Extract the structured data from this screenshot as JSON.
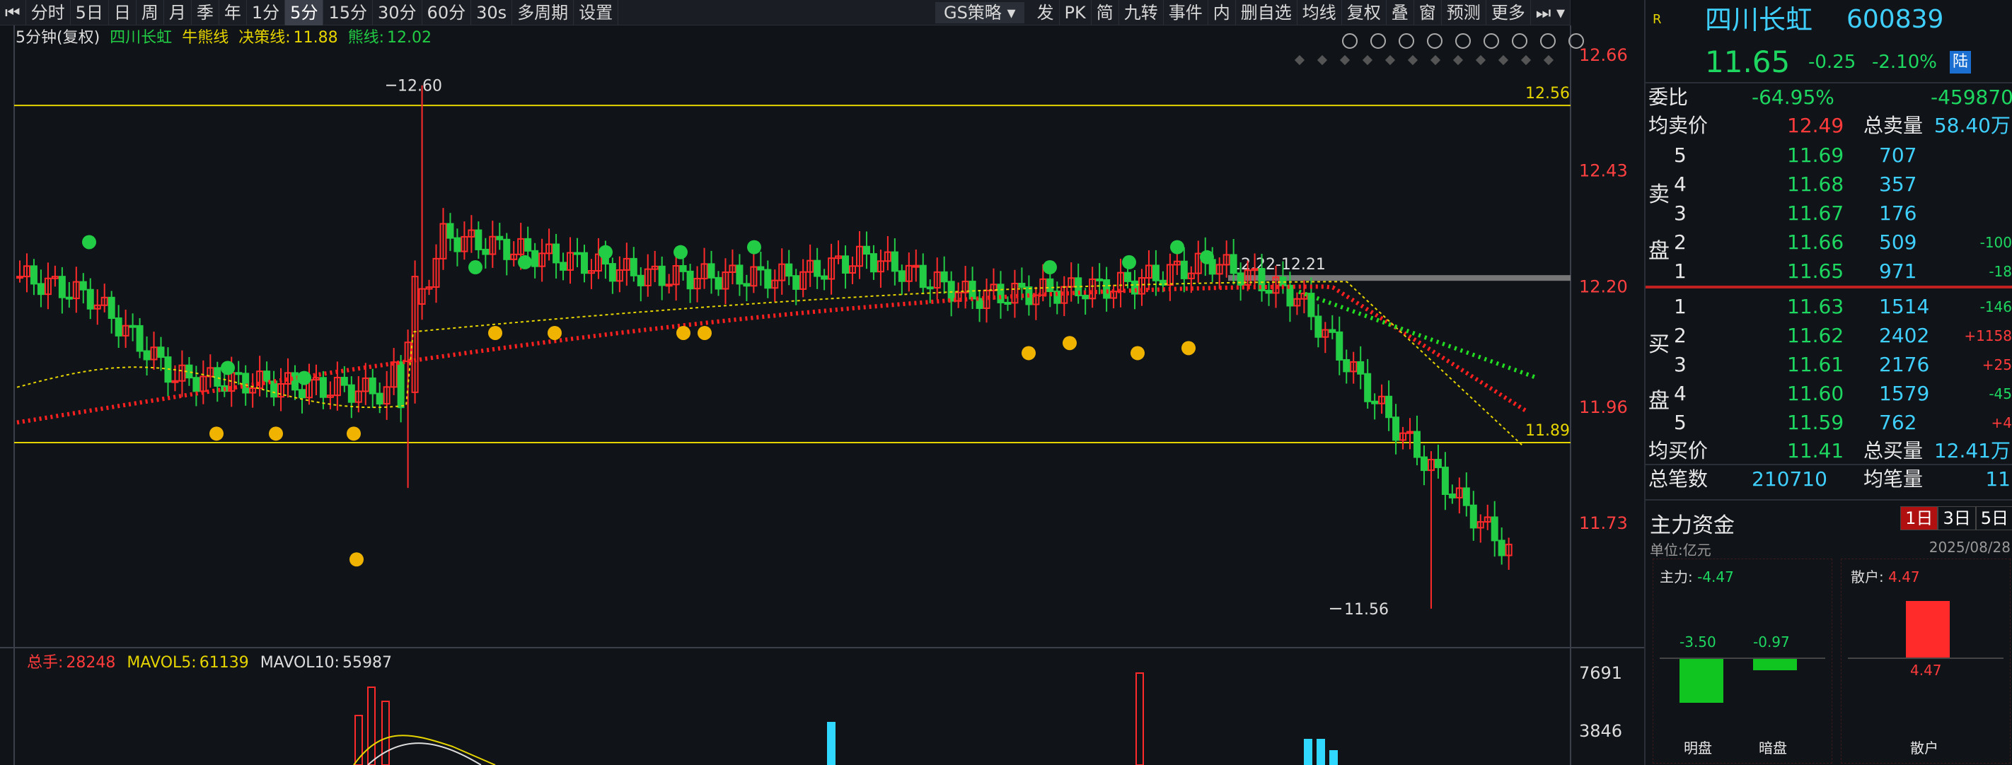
{
  "toolbar": {
    "items": [
      "分时",
      "5日",
      "日",
      "周",
      "月",
      "季",
      "年",
      "1分",
      "5分",
      "15分",
      "30分",
      "60分",
      "30s",
      "多周期",
      "设置"
    ],
    "active": "5分",
    "strategy": "GS策略",
    "right_items": [
      "发",
      "PK",
      "简",
      "九转",
      "事件",
      "内",
      "删自选",
      "均线",
      "复权",
      "叠",
      "窗",
      "预测",
      "更多"
    ]
  },
  "chart_info": {
    "period": "5分钟(复权)",
    "name": "四川长虹",
    "bull_label": "牛熊线",
    "decision_label": "决策线:",
    "decision_value": "11.88",
    "bear_label": "熊线:",
    "bear_value": "12.02"
  },
  "price_axis": [
    "12.66",
    "12.43",
    "12.20",
    "11.96",
    "11.73"
  ],
  "labels": {
    "high": "12.60",
    "low": "11.56",
    "range": "12.22-12.21",
    "line_top": "12.56",
    "line_bottom": "11.89"
  },
  "volume": {
    "total_label": "总手:",
    "total": "28248",
    "ma5_label": "MAVOL5:",
    "ma5": "61139",
    "ma10_label": "MAVOL10:",
    "ma10": "55987",
    "axis": [
      "7691",
      "3846"
    ]
  },
  "colors": {
    "up": "#ff2b2b",
    "down": "#22cc44",
    "bg": "#101318",
    "yellow": "#e6d400"
  },
  "quote": {
    "name": "四川长虹",
    "code": "600839",
    "price": "11.65",
    "change": "-0.25",
    "pct": "-2.10%",
    "market": "陆",
    "webi_label": "委比",
    "webi": "-64.95%",
    "weicha": "-459870",
    "avg_sell_label": "均卖价",
    "avg_sell": "12.49",
    "total_sell_label": "总卖量",
    "total_sell": "58.40万",
    "sell": [
      {
        "lv": "5",
        "p": "11.69",
        "v": "707",
        "d": ""
      },
      {
        "lv": "4",
        "p": "11.68",
        "v": "357",
        "d": ""
      },
      {
        "lv": "3",
        "p": "11.67",
        "v": "176",
        "d": ""
      },
      {
        "lv": "2",
        "p": "11.66",
        "v": "509",
        "d": "-100"
      },
      {
        "lv": "1",
        "p": "11.65",
        "v": "971",
        "d": "-18"
      }
    ],
    "sell_side": "卖",
    "buy_side": "买",
    "pan": "盘",
    "buy": [
      {
        "lv": "1",
        "p": "11.63",
        "v": "1514",
        "d": "-146"
      },
      {
        "lv": "2",
        "p": "11.62",
        "v": "2402",
        "d": "+1158"
      },
      {
        "lv": "3",
        "p": "11.61",
        "v": "2176",
        "d": "+25"
      },
      {
        "lv": "4",
        "p": "11.60",
        "v": "1579",
        "d": "-45"
      },
      {
        "lv": "5",
        "p": "11.59",
        "v": "762",
        "d": "+4"
      }
    ],
    "avg_buy_label": "均买价",
    "avg_buy": "11.41",
    "total_buy_label": "总买量",
    "total_buy": "12.41万",
    "total_trades_label": "总笔数",
    "total_trades": "210710",
    "avg_trade_label": "均笔量",
    "avg_trade": "11"
  },
  "funds": {
    "title": "主力资金",
    "tabs": [
      "1日",
      "3日",
      "5日"
    ],
    "unit": "单位:亿元",
    "date": "2025/08/28",
    "main_label": "主力:",
    "main": "-4.47",
    "retail_label": "散户:",
    "retail": "4.47",
    "ming": "-3.50",
    "an": "-0.97",
    "retail_bar": "4.47",
    "ming_label": "明盘",
    "an_label": "暗盘",
    "retail_name": "散户"
  }
}
